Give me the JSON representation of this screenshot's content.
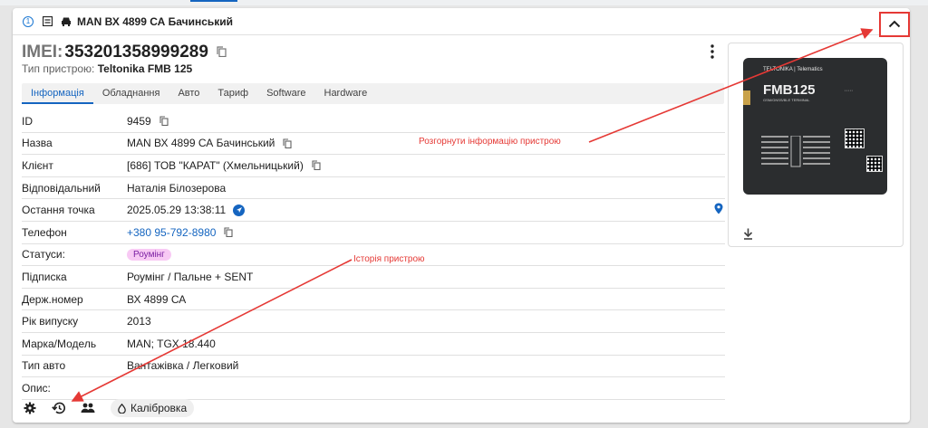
{
  "header": {
    "number": "1",
    "title": "MAN ВХ 4899 СА Бачинський"
  },
  "device": {
    "imei_label": "IMEI:",
    "imei_value": "353201358999289",
    "type_label": "Тип пристрою:",
    "type_value": "Teltonika FMB 125"
  },
  "tabs": [
    "Інформація",
    "Обладнання",
    "Авто",
    "Тариф",
    "Software",
    "Hardware"
  ],
  "info": {
    "id_label": "ID",
    "id_value": "9459",
    "name_label": "Назва",
    "name_value": "MAN ВХ 4899 СА Бачинський",
    "client_label": "Клієнт",
    "client_value": "[686] ТОВ \"КАРАТ\" (Хмельницький)",
    "responsible_label": "Відповідальний",
    "responsible_value": "Наталія Білозерова",
    "lastpoint_label": "Остання точка",
    "lastpoint_value": "2025.05.29 13:38:11",
    "phone_label": "Телефон",
    "phone_value": "+380 95-792-8980",
    "status_label": "Статуси:",
    "status_value": "Роумінг",
    "subscription_label": "Підписка",
    "subscription_value": "Роумінг / Пальне + SENT",
    "plate_label": "Держ.номер",
    "plate_value": "ВХ 4899 СА",
    "year_label": "Рік випуску",
    "year_value": "2013",
    "model_label": "Марка/Модель",
    "model_value": "MAN; TGX 18.440",
    "cartype_label": "Тип авто",
    "cartype_value": "Вантажівка / Легковий",
    "desc_label": "Опис:",
    "desc_value": ""
  },
  "image": {
    "brand": "TELTONIKA | Telematics",
    "model": "FMB125",
    "sub": "GSM/GNSS/BLE TERMINAL"
  },
  "bottom": {
    "calibration_label": "Калібровка"
  },
  "annotations": {
    "expand_text": "Розгорнути інформацію пристрою",
    "history_text": "Історія пристрою"
  },
  "colors": {
    "accent": "#1565c0",
    "annotation": "#e53935",
    "badge_bg": "#f8c9f4"
  }
}
